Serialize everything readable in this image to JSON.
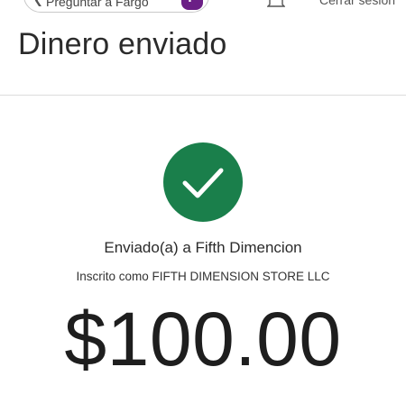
{
  "header": {
    "ask_label": "Preguntar a Fargo",
    "fargo_badge": "F",
    "sign_off": "Cerrar sesión"
  },
  "page": {
    "title": "Dinero enviado"
  },
  "confirmation": {
    "icon": "check-circle-icon",
    "icon_color": "#1a7f4b",
    "sent_to": "Enviado(a) a Fifth Dimencion",
    "registered_as": "Inscrito como FIFTH DIMENSION STORE LLC",
    "amount": "$100.00"
  }
}
